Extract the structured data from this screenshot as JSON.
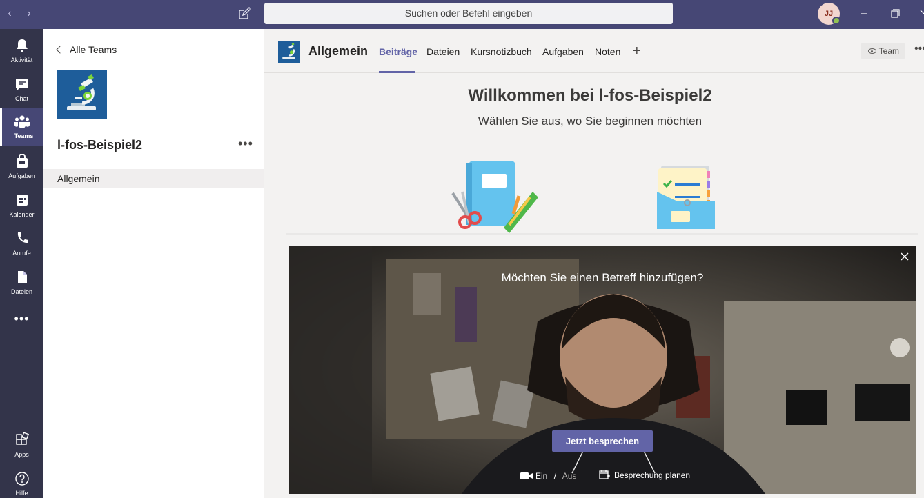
{
  "titlebar": {
    "search_placeholder": "Suchen oder Befehl eingeben",
    "user_initials": "JJ"
  },
  "rail": {
    "items": [
      {
        "label": "Aktivität",
        "icon": "bell-icon"
      },
      {
        "label": "Chat",
        "icon": "chat-icon"
      },
      {
        "label": "Teams",
        "icon": "teams-icon"
      },
      {
        "label": "Aufgaben",
        "icon": "assignments-icon"
      },
      {
        "label": "Kalender",
        "icon": "calendar-icon"
      },
      {
        "label": "Anrufe",
        "icon": "phone-icon"
      },
      {
        "label": "Dateien",
        "icon": "file-icon"
      }
    ],
    "more": "•••",
    "apps_label": "Apps",
    "help_label": "Hilfe"
  },
  "panel": {
    "back_label": "Alle Teams",
    "team_name": "l-fos-Beispiel2",
    "more": "•••",
    "channels": [
      {
        "label": "Allgemein"
      }
    ]
  },
  "header": {
    "channel_title": "Allgemein",
    "tabs": [
      {
        "label": "Beiträge"
      },
      {
        "label": "Dateien"
      },
      {
        "label": "Kursnotizbuch"
      },
      {
        "label": "Aufgaben"
      },
      {
        "label": "Noten"
      }
    ],
    "plus": "+",
    "team_button": "Team",
    "more": "•••"
  },
  "welcome": {
    "title": "Willkommen bei l-fos-Beispiel2",
    "subtitle": "Wählen Sie aus, wo Sie beginnen möchten"
  },
  "video": {
    "prompt": "Möchten Sie einen Betreff hinzufügen?",
    "meet_button": "Jetzt besprechen",
    "cam_on": "Ein",
    "cam_sep": "/",
    "cam_off": "Aus",
    "schedule": "Besprechung planen"
  },
  "colors": {
    "titlebar": "#464775",
    "rail": "#33344a",
    "accent": "#6264a7"
  }
}
